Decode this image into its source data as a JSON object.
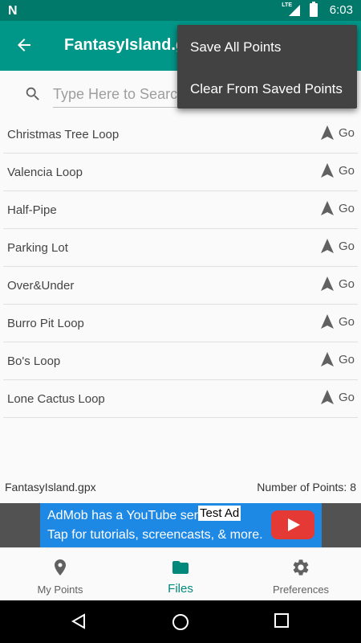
{
  "status_bar": {
    "network": "LTE",
    "time": "6:03"
  },
  "app_bar": {
    "title": "FantasyIsland.gpx"
  },
  "search": {
    "placeholder": "Type Here to Search"
  },
  "list": {
    "go_label": "Go",
    "items": [
      "Christmas Tree Loop",
      "Valencia Loop",
      "Half-Pipe",
      "Parking Lot",
      "Over&Under",
      "Burro Pit Loop",
      "Bo's Loop",
      "Lone Cactus Loop"
    ]
  },
  "footer": {
    "file_name": "FantasyIsland.gpx",
    "points_count": "Number of Points: 8"
  },
  "ad": {
    "badge": "Test Ad",
    "line1": "AdMob has a YouTube series!",
    "line2": "Tap for tutorials, screencasts, & more."
  },
  "bottom_nav": {
    "tabs": [
      "My Points",
      "Files",
      "Preferences"
    ]
  },
  "menu": {
    "items": [
      "Save All Points",
      "Clear From Saved Points"
    ]
  },
  "colors": {
    "primary": "#009688",
    "primary_dark": "#00796b",
    "menu_bg": "#424242"
  }
}
